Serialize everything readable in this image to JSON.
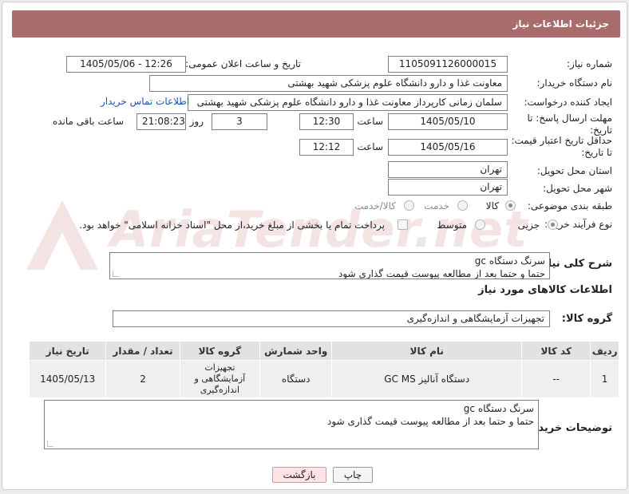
{
  "header": {
    "title": "جزئیات اطلاعات نیاز"
  },
  "watermark": {
    "text": "AriaTender.net"
  },
  "fields": {
    "need_number_label": "شماره نیاز:",
    "need_number": "1105091126000015",
    "announce_label": "تاریخ و ساعت اعلان عمومی:",
    "announce_value": "1405/05/06 - 12:26",
    "buyer_org_label": "نام دستگاه خریدار:",
    "buyer_org": "معاونت غذا و دارو دانشگاه علوم پزشکی شهید بهشتی",
    "creator_label": "ایجاد کننده درخواست:",
    "creator": "سلمان زمانی کارپرداز معاونت غذا و دارو دانشگاه علوم پزشکی شهید بهشتی",
    "buyer_contact_link": "اطلاعات تماس خریدار",
    "deadline_label": "مهلت ارسال پاسخ: تا تاریخ:",
    "deadline_date": "1405/05/10",
    "time_label": "ساعت",
    "deadline_time": "12:30",
    "days_value": "3",
    "days_label": "روز و",
    "remaining_value": "21:08:23",
    "remaining_label": "ساعت باقی مانده",
    "min_validity_label": "حداقل تاریخ اعتبار قیمت: تا تاریخ:",
    "validity_date": "1405/05/16",
    "validity_time": "12:12",
    "province_label": "استان محل تحویل:",
    "province": "تهران",
    "city_label": "شهر محل تحویل:",
    "city": "تهران",
    "category_label": "طبقه بندی موضوعی:",
    "category_options": [
      "کالا",
      "خدمت",
      "کالا/خدمت"
    ],
    "process_label": "نوع فرآیند خرید :",
    "process_options": [
      "جزیی",
      "متوسط"
    ],
    "payment_note": "پرداخت تمام یا بخشی از مبلغ خرید،از محل \"اسناد خزانه اسلامی\" خواهد بود."
  },
  "summary": {
    "label": "شرح کلی نیاز:",
    "lines": [
      "سرنگ دستگاه gc",
      "حتما و حتما بعد از مطالعه پیوست قیمت گذاری شود"
    ]
  },
  "goods_info": {
    "section_title": "اطلاعات کالاهای مورد نیاز",
    "group_label": "گروه کالا:",
    "group_value": "تجهیزات آزمایشگاهی و اندازه‌گیری"
  },
  "table": {
    "headers": [
      "ردیف",
      "کد کالا",
      "نام کالا",
      "واحد شمارش",
      "گروه کالا",
      "تعداد / مقدار",
      "تاریخ نیاز"
    ],
    "rows": [
      [
        "1",
        "--",
        "دستگاه آنالیز GC MS",
        "دستگاه",
        "تجهیزات آزمایشگاهی و اندازه‌گیری",
        "2",
        "1405/05/13"
      ]
    ]
  },
  "buyer_notes": {
    "label": "توضیحات خریدار:",
    "lines": [
      "سرنگ دستگاه gc",
      "حتما و حتما بعد از مطالعه پیوست قیمت گذاری شود"
    ]
  },
  "buttons": {
    "print": "چاپ",
    "back": "بازگشت"
  }
}
